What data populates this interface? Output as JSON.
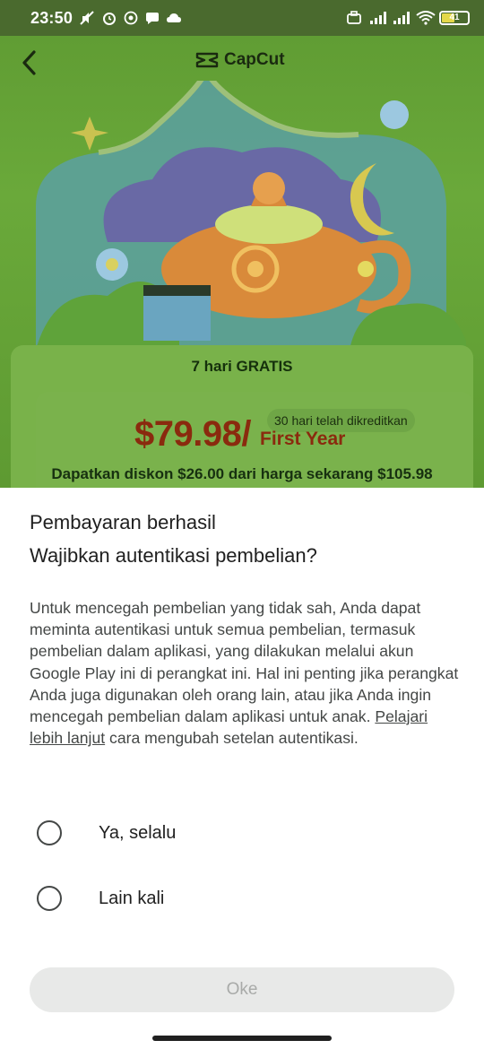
{
  "status_bar": {
    "time": "23:50",
    "battery": "41"
  },
  "header": {
    "logo_text": "CapCut"
  },
  "offer": {
    "trial": "7 hari GRATIS",
    "badge": "30 hari telah dikreditkan",
    "price": "$79.98/",
    "term": "First Year",
    "discount": "Dapatkan diskon $26.00 dari harga sekarang $105.98"
  },
  "dialog": {
    "title": "Pembayaran berhasil",
    "question": "Wajibkan autentikasi pembelian?",
    "body_text": "Untuk mencegah pembelian yang tidak sah, Anda dapat meminta autentikasi untuk semua pembelian, termasuk pembelian dalam aplikasi, yang dilakukan melalui akun Google Play ini di perangkat ini. Hal ini penting jika perangkat Anda juga digunakan oleh orang lain, atau jika Anda ingin mencegah pembelian dalam aplikasi untuk anak.",
    "learn_more": "Pelajari lebih lanjut",
    "body_suffix": "cara mengubah setelan autentikasi.",
    "options": [
      {
        "label": "Ya, selalu",
        "selected": false
      },
      {
        "label": "Lain kali",
        "selected": false
      }
    ],
    "ok_label": "Oke"
  },
  "colors": {
    "dim_green": "#6aa93a",
    "price_red": "#8a2a0e",
    "button_disabled": "#e8e9e8"
  }
}
